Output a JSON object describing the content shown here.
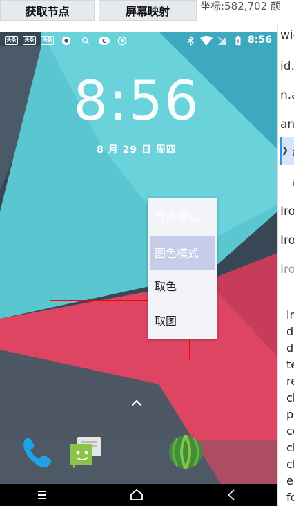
{
  "toolbar": {
    "get_nodes_label": "获取节点",
    "screen_map_label": "屏幕映射",
    "coords_text": "坐标:582,702 颜"
  },
  "statusbar": {
    "notifications": [
      "头条",
      "头条",
      "头条"
    ],
    "time": "8:56"
  },
  "lockscreen": {
    "clock": "8:56",
    "date": "8 月 29 日 周四"
  },
  "context_menu": {
    "items": [
      "节点模式",
      "图色模式",
      "取色",
      "取图"
    ],
    "selected_index": 1
  },
  "dock": {
    "icons": [
      "phone-icon",
      "messaging-icon",
      "watermelon-app-icon"
    ]
  },
  "navbar": {
    "icons": [
      "menu-icon",
      "home-icon",
      "back-icon"
    ]
  },
  "right_panel": {
    "tree_lines": [
      "wid",
      "id.",
      "n.a",
      "and",
      "a",
      "a",
      "Iro",
      "Iro",
      "Iro"
    ],
    "props": [
      "in",
      "d",
      "d",
      "te",
      "re",
      "cl",
      "p",
      "ce",
      "cl",
      "cl",
      "e",
      "fo"
    ]
  },
  "colors": {
    "menu_selected": "#c5cdea",
    "selection_box": "#ff0000",
    "wall_teal": "#5ec8d0",
    "wall_pink": "#e24965"
  }
}
